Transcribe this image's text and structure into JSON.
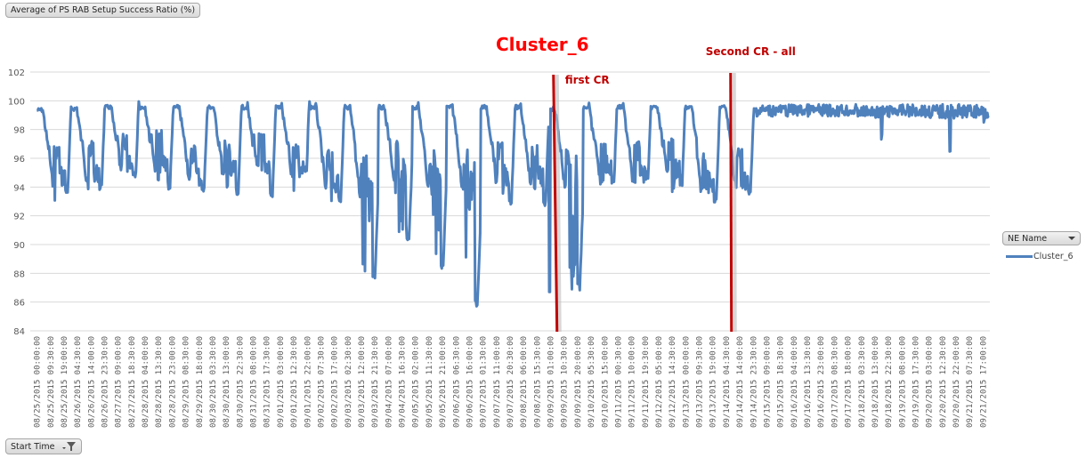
{
  "pivot": {
    "measure_button": "Average of PS RAB Setup Success Ratio (%)",
    "axis_field_button": "Start Time",
    "legend_field_button": "NE Name"
  },
  "chart_data": {
    "type": "line",
    "title": "",
    "xlabel": "Start Time",
    "ylabel": "Average of PS RAB Setup Success Ratio (%)",
    "ylim": [
      84,
      102
    ],
    "yticks": [
      84,
      86,
      88,
      90,
      92,
      94,
      96,
      98,
      100,
      102
    ],
    "grid": true,
    "legend": {
      "title": "NE Name",
      "placement": "right",
      "entries": [
        "Cluster_6"
      ]
    },
    "series_color": "#4f81bd",
    "x_tick_labels": [
      "08/25/2015 00:00:00",
      "08/25/2015 09:30:00",
      "08/25/2015 19:00:00",
      "08/26/2015 04:30:00",
      "08/26/2015 14:00:00",
      "08/26/2015 23:30:00",
      "08/27/2015 09:00:00",
      "08/27/2015 18:30:00",
      "08/28/2015 04:00:00",
      "08/28/2015 13:30:00",
      "08/28/2015 23:00:00",
      "08/29/2015 08:30:00",
      "08/29/2015 18:00:00",
      "08/30/2015 03:30:00",
      "08/30/2015 13:00:00",
      "08/30/2015 22:30:00",
      "08/31/2015 08:00:00",
      "08/31/2015 17:30:00",
      "09/01/2015 03:00:00",
      "09/01/2015 12:30:00",
      "09/01/2015 22:00:00",
      "09/02/2015 07:30:00",
      "09/02/2015 17:00:00",
      "09/03/2015 02:30:00",
      "09/03/2015 12:00:00",
      "09/03/2015 21:30:00",
      "09/04/2015 07:00:00",
      "09/04/2015 16:30:00",
      "09/05/2015 02:00:00",
      "09/05/2015 11:30:00",
      "09/05/2015 21:00:00",
      "09/06/2015 06:30:00",
      "09/06/2015 16:00:00",
      "09/07/2015 01:30:00",
      "09/07/2015 11:00:00",
      "09/07/2015 20:30:00",
      "09/08/2015 06:00:00",
      "09/08/2015 15:30:00",
      "09/09/2015 01:00:00",
      "09/09/2015 10:30:00",
      "09/09/2015 20:00:00",
      "09/10/2015 05:30:00",
      "09/10/2015 15:00:00",
      "09/11/2015 00:30:00",
      "09/11/2015 10:00:00",
      "09/11/2015 19:30:00",
      "09/12/2015 05:00:00",
      "09/12/2015 14:30:00",
      "09/13/2015 00:00:00",
      "09/13/2015 09:30:00",
      "09/13/2015 19:00:00",
      "09/14/2015 04:30:00",
      "09/14/2015 14:00:00",
      "09/14/2015 23:30:00",
      "09/15/2015 09:00:00",
      "09/15/2015 18:30:00",
      "09/16/2015 04:00:00",
      "09/16/2015 13:30:00",
      "09/16/2015 23:00:00",
      "09/17/2015 08:30:00",
      "09/17/2015 18:00:00",
      "09/18/2015 03:30:00",
      "09/18/2015 13:00:00",
      "09/18/2015 22:30:00",
      "09/19/2015 08:00:00",
      "09/19/2015 17:30:00",
      "09/20/2015 03:00:00",
      "09/20/2015 12:30:00",
      "09/20/2015 22:00:00",
      "09/21/2015 07:30:00",
      "09/21/2015 17:00:00"
    ],
    "daily_profile_note": "Values approximated per day (min/max of the daily cycle) read from gridlines",
    "series": [
      {
        "name": "Cluster_6",
        "daily": [
          {
            "date": "08/25/2015",
            "max": 99.7,
            "min": 93.3,
            "mid": 97.0
          },
          {
            "date": "08/26/2015",
            "max": 99.8,
            "min": 93.8,
            "mid": 97.2
          },
          {
            "date": "08/27/2015",
            "max": 99.9,
            "min": 94.6,
            "mid": 97.7
          },
          {
            "date": "08/28/2015",
            "max": 99.9,
            "min": 93.7,
            "mid": 98.0
          },
          {
            "date": "08/29/2015",
            "max": 99.9,
            "min": 93.6,
            "mid": 97.0
          },
          {
            "date": "08/30/2015",
            "max": 99.9,
            "min": 93.4,
            "mid": 97.3
          },
          {
            "date": "08/31/2015",
            "max": 99.9,
            "min": 93.2,
            "mid": 97.8
          },
          {
            "date": "09/01/2015",
            "max": 99.9,
            "min": 95.0,
            "mid": 97.4
          },
          {
            "date": "09/02/2015",
            "max": 99.9,
            "min": 92.8,
            "mid": 96.6
          },
          {
            "date": "09/03/2015",
            "max": 99.9,
            "min": 87.3,
            "mid": 96.3
          },
          {
            "date": "09/04/2015",
            "max": 99.9,
            "min": 90.0,
            "mid": 97.2
          },
          {
            "date": "09/05/2015",
            "max": 99.9,
            "min": 88.3,
            "mid": 96.8
          },
          {
            "date": "09/06/2015",
            "max": 99.9,
            "min": 85.4,
            "mid": 96.6
          },
          {
            "date": "09/07/2015",
            "max": 99.9,
            "min": 92.6,
            "mid": 97.1
          },
          {
            "date": "09/08/2015",
            "max": 99.9,
            "min": 92.7,
            "mid": 97.0
          },
          {
            "date": "09/09/2015",
            "max": 99.8,
            "min": 86.7,
            "mid": 96.8
          },
          {
            "date": "09/10/2015",
            "max": 99.9,
            "min": 93.9,
            "mid": 97.7
          },
          {
            "date": "09/11/2015",
            "max": 99.9,
            "min": 94.4,
            "mid": 97.2
          },
          {
            "date": "09/12/2015",
            "max": 99.9,
            "min": 94.1,
            "mid": 97.4
          },
          {
            "date": "09/13/2015",
            "max": 99.9,
            "min": 92.9,
            "mid": 96.5
          },
          {
            "date": "09/14/2015",
            "max": 99.9,
            "min": 93.4,
            "mid": 96.8
          },
          {
            "date": "09/15/2015",
            "max": 99.9,
            "min": 98.6,
            "mid": 99.3
          },
          {
            "date": "09/16/2015",
            "max": 99.9,
            "min": 98.7,
            "mid": 99.3
          },
          {
            "date": "09/17/2015",
            "max": 99.9,
            "min": 98.6,
            "mid": 99.3
          },
          {
            "date": "09/18/2015",
            "max": 99.8,
            "min": 97.3,
            "mid": 99.2
          },
          {
            "date": "09/19/2015",
            "max": 99.9,
            "min": 98.5,
            "mid": 99.3
          },
          {
            "date": "09/20/2015",
            "max": 99.9,
            "min": 96.3,
            "mid": 99.2
          },
          {
            "date": "09/21/2015",
            "max": 99.9,
            "min": 98.2,
            "mid": 99.2
          }
        ]
      }
    ],
    "annotations": [
      {
        "text": "Cluster_6",
        "kind": "title-like",
        "color": "#ff0000"
      },
      {
        "text": "first CR",
        "kind": "vertical-marker",
        "at": "09/09/2015 03:00:00",
        "color": "#c00000"
      },
      {
        "text": "Second CR  - all",
        "kind": "vertical-marker",
        "at": "09/14/2015 07:30:00",
        "color": "#c00000"
      }
    ]
  }
}
